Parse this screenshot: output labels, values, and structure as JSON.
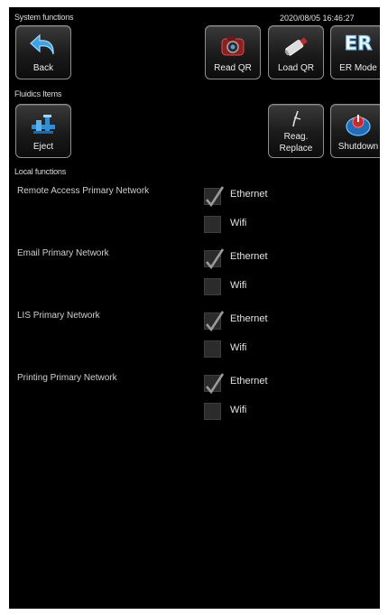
{
  "header": {
    "section_label": "System functions",
    "datetime": "2020/08/05 16:46:27"
  },
  "system_buttons": [
    {
      "label": "Back",
      "icon": "back-arrow-icon"
    },
    {
      "label": "Read QR",
      "icon": "camera-icon"
    },
    {
      "label": "Load QR",
      "icon": "usb-stick-icon"
    },
    {
      "label": "ER Mode",
      "icon": "er-icon",
      "icon_text": "ER"
    }
  ],
  "fluidics": {
    "section_label": "Fluidics Items",
    "buttons": [
      {
        "label": "Eject",
        "icon": "eject-icon"
      },
      {
        "label_lines": [
          "Reag.",
          "Replace"
        ],
        "icon": "pipette-icon"
      },
      {
        "label": "Shutdown",
        "icon": "power-icon"
      }
    ]
  },
  "local": {
    "section_label": "Local functions",
    "networks": [
      {
        "label": "Remote Access Primary Network",
        "options": [
          {
            "label": "Ethernet",
            "checked": true
          },
          {
            "label": "Wifi",
            "checked": false
          }
        ]
      },
      {
        "label": "Email Primary Network",
        "options": [
          {
            "label": "Ethernet",
            "checked": true
          },
          {
            "label": "Wifi",
            "checked": false
          }
        ]
      },
      {
        "label": "LIS Primary Network",
        "options": [
          {
            "label": "Ethernet",
            "checked": true
          },
          {
            "label": "Wifi",
            "checked": false
          }
        ]
      },
      {
        "label": "Printing Primary Network",
        "options": [
          {
            "label": "Ethernet",
            "checked": true
          },
          {
            "label": "Wifi",
            "checked": false
          }
        ]
      }
    ]
  },
  "colors": {
    "screen_bg": "#000000",
    "icon_blue": "#2f8fd0",
    "icon_red": "#c62a2a",
    "check": "#9a9a9a"
  }
}
